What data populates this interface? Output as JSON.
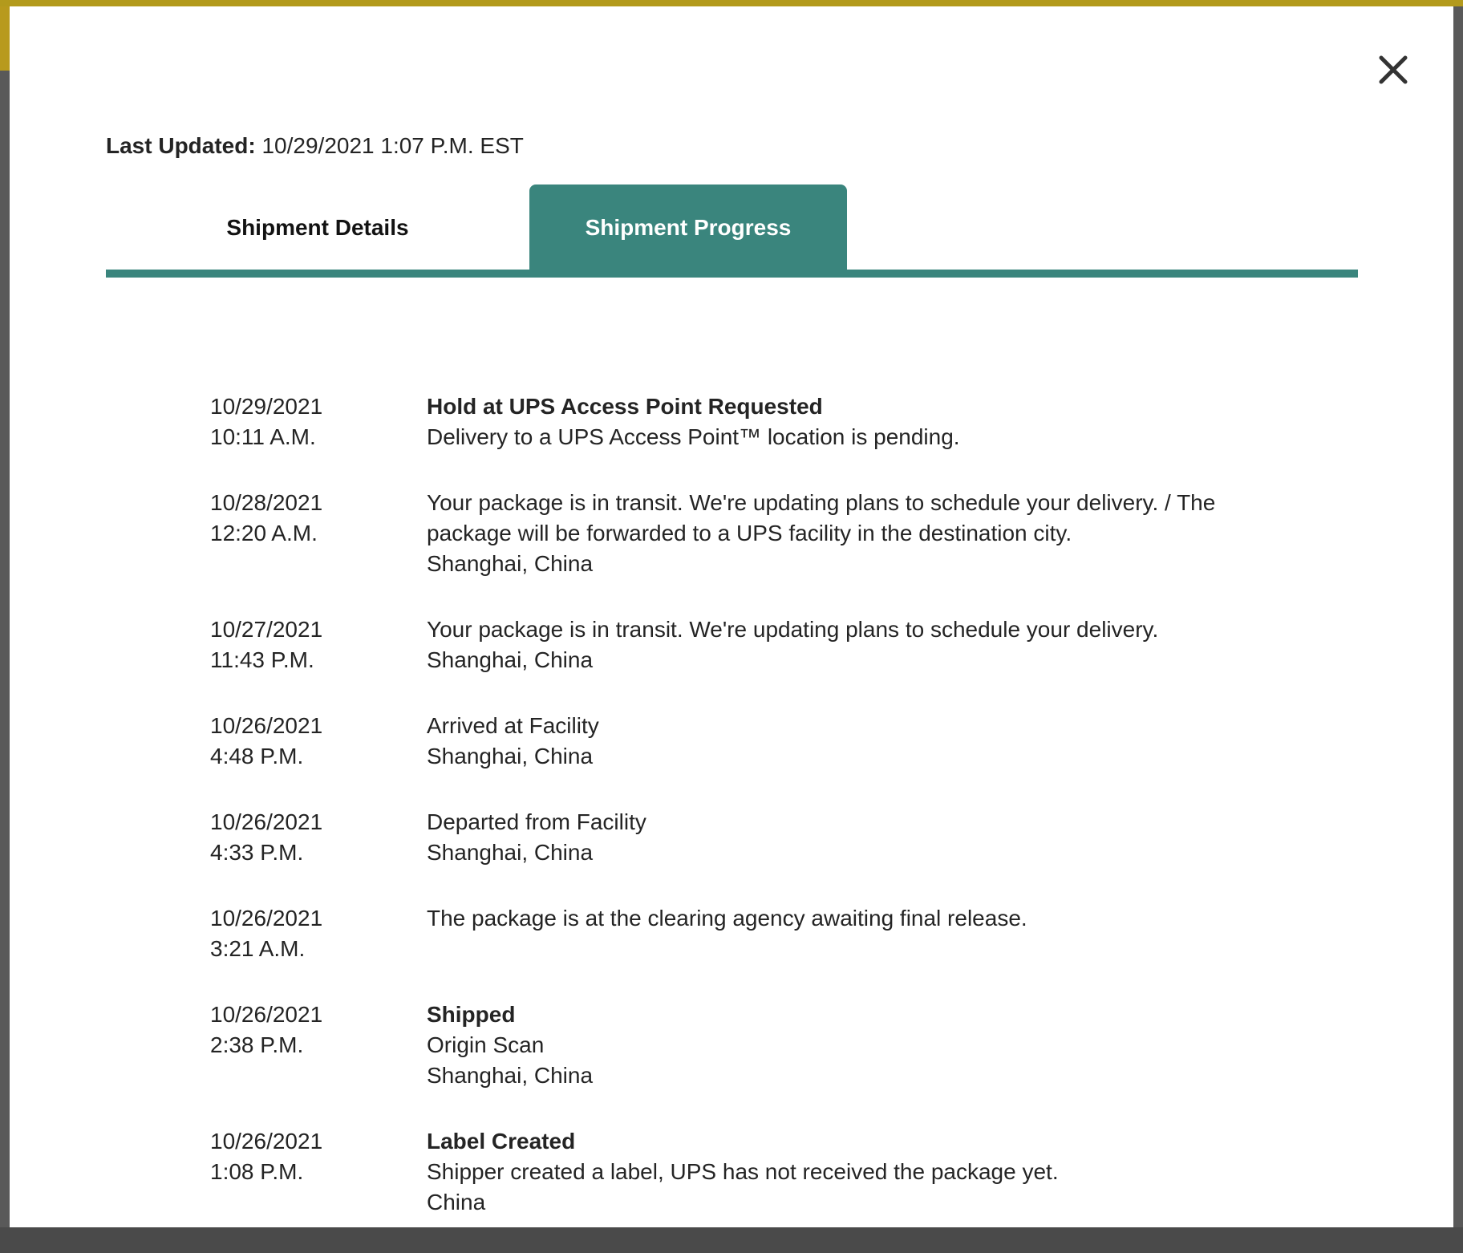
{
  "modal": {
    "close_icon": "close-icon",
    "last_updated_label": "Last Updated:",
    "last_updated_value": " 10/29/2021 1:07 P.M. EST",
    "tabs": [
      {
        "label": "Shipment Details",
        "active": false
      },
      {
        "label": "Shipment Progress",
        "active": true
      }
    ],
    "accent_color": "#3a857d"
  },
  "events": [
    {
      "date": "10/29/2021",
      "time": "10:11 A.M.",
      "status": "Hold at UPS Access Point Requested",
      "description": "Delivery to a UPS Access Point™ location is pending.",
      "location": ""
    },
    {
      "date": "10/28/2021",
      "time": "12:20 A.M.",
      "status": "",
      "description": "Your package is in transit. We're updating plans to schedule your delivery. / The package will be forwarded to a UPS facility in the destination city.",
      "location": "Shanghai, China"
    },
    {
      "date": "10/27/2021",
      "time": "11:43 P.M.",
      "status": "",
      "description": "Your package is in transit. We're updating plans to schedule your delivery.",
      "location": "Shanghai, China"
    },
    {
      "date": "10/26/2021",
      "time": "4:48 P.M.",
      "status": "",
      "description": "Arrived at Facility",
      "location": "Shanghai, China"
    },
    {
      "date": "10/26/2021",
      "time": "4:33 P.M.",
      "status": "",
      "description": "Departed from Facility",
      "location": "Shanghai, China"
    },
    {
      "date": "10/26/2021",
      "time": "3:21 A.M.",
      "status": "",
      "description": "The package is at the clearing agency awaiting final release.",
      "location": ""
    },
    {
      "date": "10/26/2021",
      "time": "2:38 P.M.",
      "status": "Shipped",
      "description": "Origin Scan",
      "location": "Shanghai, China"
    },
    {
      "date": "10/26/2021",
      "time": "1:08 P.M.",
      "status": "Label Created",
      "description": "Shipper created a label, UPS has not received the package yet.",
      "location": "China"
    }
  ]
}
